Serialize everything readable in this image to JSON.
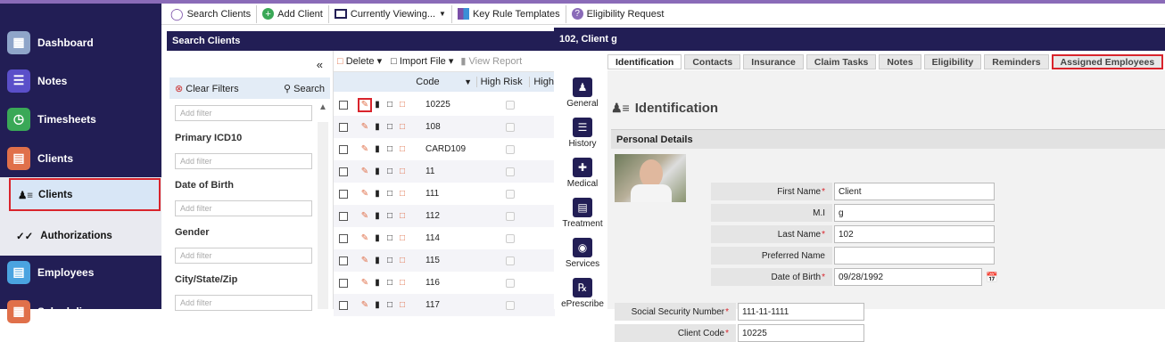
{
  "toolbar": {
    "search_clients": "Search Clients",
    "add_client": "Add Client",
    "currently_viewing": "Currently Viewing...",
    "key_rule_templates": "Key Rule Templates",
    "eligibility_request": "Eligibility Request"
  },
  "sidebar": {
    "dashboard": "Dashboard",
    "notes": "Notes",
    "timesheets": "Timesheets",
    "clients": "Clients",
    "clients_sub": "Clients",
    "authorizations": "Authorizations",
    "employees": "Employees",
    "scheduling": "Scheduling"
  },
  "search_panel": {
    "title": "Search Clients",
    "collapse": "«",
    "clear_filters": "Clear Filters",
    "search": "Search",
    "add_filter": "Add filter",
    "filter_labels": [
      "Primary ICD10",
      "Date of Birth",
      "Gender",
      "City/State/Zip"
    ]
  },
  "grid": {
    "delete": "Delete",
    "import_file": "Import File",
    "view_report": "View Report",
    "col_code": "Code",
    "col_high_risk": "High Risk",
    "col_more": "High",
    "codes": [
      "10225",
      "108",
      "CARD109",
      "11",
      "111",
      "112",
      "114",
      "115",
      "116",
      "117"
    ]
  },
  "detail": {
    "title": "102, Client g",
    "tabs": [
      "Identification",
      "Contacts",
      "Insurance",
      "Claim Tasks",
      "Notes",
      "Eligibility",
      "Reminders",
      "Assigned Employees"
    ],
    "side_tabs": [
      "General",
      "History",
      "Medical",
      "Treatment",
      "Services",
      "ePrescribe"
    ],
    "section_title": "Identification",
    "personal_details": "Personal Details",
    "fields": {
      "first_name_label": "First Name",
      "first_name": "Client",
      "mi_label": "M.I",
      "mi": "g",
      "last_name_label": "Last Name",
      "last_name": "102",
      "preferred_name_label": "Preferred Name",
      "preferred_name": "",
      "dob_label": "Date of Birth",
      "dob": "09/28/1992",
      "ssn_label": "Social Security Number",
      "ssn": "111-11-1111",
      "client_code_label": "Client Code",
      "client_code": "10225"
    }
  },
  "colors": {
    "nav": "#221e55",
    "accent_red": "#d9242c",
    "header_purple": "#8a6bb8"
  }
}
